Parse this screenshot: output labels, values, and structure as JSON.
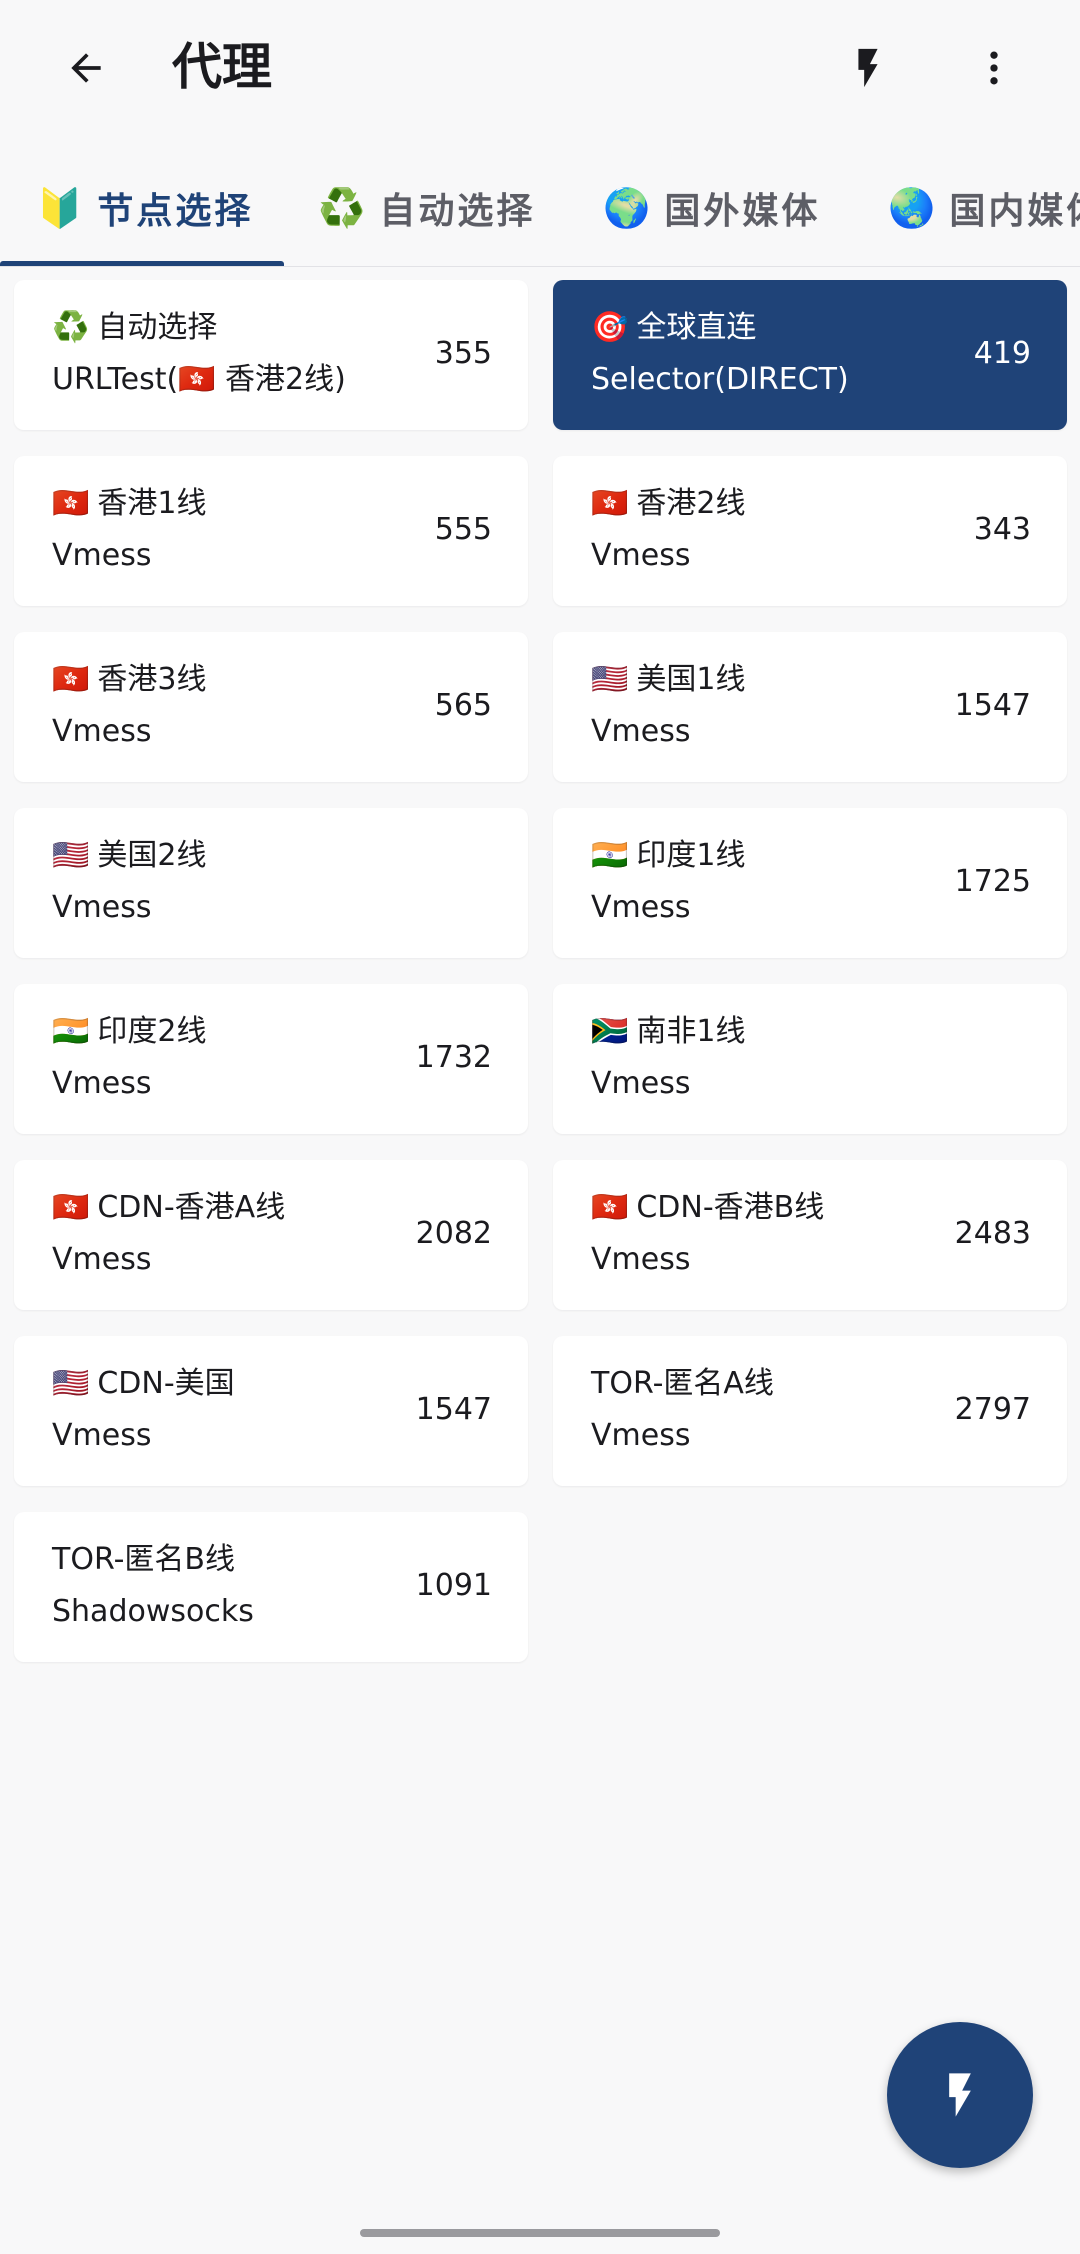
{
  "appbar": {
    "title": "代理",
    "back_icon": "arrow-left",
    "action_icon": "lightning-bolt",
    "menu_icon": "more-vertical"
  },
  "tabs": [
    {
      "emoji": "🔰",
      "label": "节点选择",
      "active": true
    },
    {
      "emoji": "♻️",
      "label": "自动选择",
      "active": false
    },
    {
      "emoji": "🌍",
      "label": "国外媒体",
      "active": false
    },
    {
      "emoji": "🌏",
      "label": "国内媒体",
      "active": false
    }
  ],
  "proxies": [
    {
      "flag": "♻️",
      "name": "自动选择",
      "type": "URLTest(🇭🇰 香港2线)",
      "delay": "355",
      "selected": false
    },
    {
      "flag": "🎯",
      "name": "全球直连",
      "type": "Selector(DIRECT)",
      "delay": "419",
      "selected": true
    },
    {
      "flag": "🇭🇰",
      "name": "香港1线",
      "type": "Vmess",
      "delay": "555",
      "selected": false
    },
    {
      "flag": "🇭🇰",
      "name": "香港2线",
      "type": "Vmess",
      "delay": "343",
      "selected": false
    },
    {
      "flag": "🇭🇰",
      "name": "香港3线",
      "type": "Vmess",
      "delay": "565",
      "selected": false
    },
    {
      "flag": "🇺🇸",
      "name": "美国1线",
      "type": "Vmess",
      "delay": "1547",
      "selected": false
    },
    {
      "flag": "🇺🇸",
      "name": "美国2线",
      "type": "Vmess",
      "delay": "",
      "selected": false
    },
    {
      "flag": "🇮🇳",
      "name": "印度1线",
      "type": "Vmess",
      "delay": "1725",
      "selected": false
    },
    {
      "flag": "🇮🇳",
      "name": "印度2线",
      "type": "Vmess",
      "delay": "1732",
      "selected": false
    },
    {
      "flag": "🇿🇦",
      "name": "南非1线",
      "type": "Vmess",
      "delay": "",
      "selected": false
    },
    {
      "flag": "🇭🇰",
      "name": "CDN-香港A线",
      "type": "Vmess",
      "delay": "2082",
      "selected": false
    },
    {
      "flag": "🇭🇰",
      "name": "CDN-香港B线",
      "type": "Vmess",
      "delay": "2483",
      "selected": false
    },
    {
      "flag": "🇺🇸",
      "name": "CDN-美国",
      "type": "Vmess",
      "delay": "1547",
      "selected": false
    },
    {
      "flag": "",
      "name": "TOR-匿名A线",
      "type": "Vmess",
      "delay": "2797",
      "selected": false
    },
    {
      "flag": "",
      "name": "TOR-匿名B线",
      "type": "Shadowsocks",
      "delay": "1091",
      "selected": false
    }
  ],
  "fab": {
    "icon": "lightning-bolt"
  },
  "colors": {
    "accent": "#1f4378",
    "background": "#f8f8f9",
    "card": "#ffffff"
  }
}
